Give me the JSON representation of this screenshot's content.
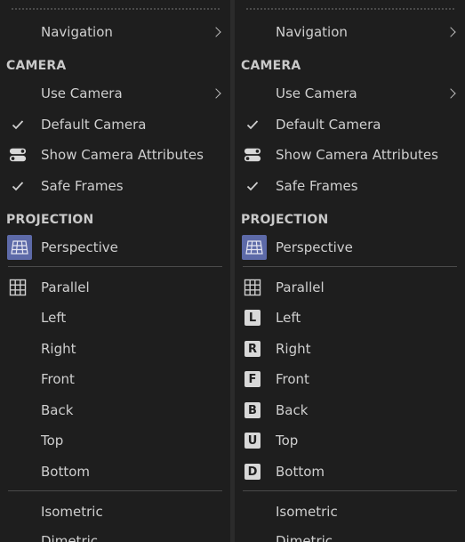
{
  "colors": {
    "background": "#1e1e1e",
    "text": "#cfcfcf",
    "accent": "#5d6aa8",
    "separator": "#4a4a4a"
  },
  "left": {
    "navigation": "Navigation",
    "camera_section": "CAMERA",
    "use_camera": "Use Camera",
    "default_camera": "Default Camera",
    "show_camera_attributes": "Show Camera Attributes",
    "safe_frames": "Safe Frames",
    "projection_section": "PROJECTION",
    "perspective": "Perspective",
    "parallel": "Parallel",
    "left": "Left",
    "right": "Right",
    "front": "Front",
    "back": "Back",
    "top": "Top",
    "bottom": "Bottom",
    "isometric": "Isometric",
    "dimetric": "Dimetric"
  },
  "right": {
    "navigation": "Navigation",
    "camera_section": "CAMERA",
    "use_camera": "Use Camera",
    "default_camera": "Default Camera",
    "show_camera_attributes": "Show Camera Attributes",
    "safe_frames": "Safe Frames",
    "projection_section": "PROJECTION",
    "perspective": "Perspective",
    "parallel": "Parallel",
    "left": "Left",
    "right": "Right",
    "front": "Front",
    "back": "Back",
    "top": "Top",
    "bottom": "Bottom",
    "isometric": "Isometric",
    "dimetric": "Dimetric",
    "icons": {
      "left": "L",
      "right": "R",
      "front": "F",
      "back": "B",
      "top": "U",
      "bottom": "D"
    }
  }
}
